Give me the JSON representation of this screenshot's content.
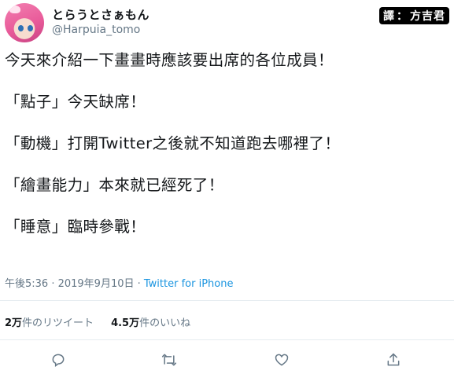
{
  "author": {
    "display_name": "とらうとさぁもん",
    "handle": "@Harpuia_tomo"
  },
  "stamp": {
    "left": "譯",
    "separator": "：",
    "right": "方吉君"
  },
  "tweet": {
    "lines": [
      "今天來介紹一下畫畫時應該要出席的各位成員！",
      "「點子」今天缺席！",
      "「動機」打開Twitter之後就不知道跑去哪裡了！",
      "「繪畫能力」本來就已經死了！",
      "「睡意」臨時參戰！"
    ],
    "time": "午後5:36 · 2019年9月10日 · ",
    "source": "Twitter for iPhone"
  },
  "stats": {
    "retweets_count": "2万",
    "retweets_label": "件のリツイート",
    "likes_count": "4.5万",
    "likes_label": "件のいいね"
  },
  "icons": [
    "reply-icon",
    "retweet-icon",
    "like-icon",
    "share-icon"
  ],
  "colors": {
    "text": "#14171a",
    "secondary": "#657786",
    "link": "#1b95e0",
    "divider": "#e6ecf0"
  }
}
